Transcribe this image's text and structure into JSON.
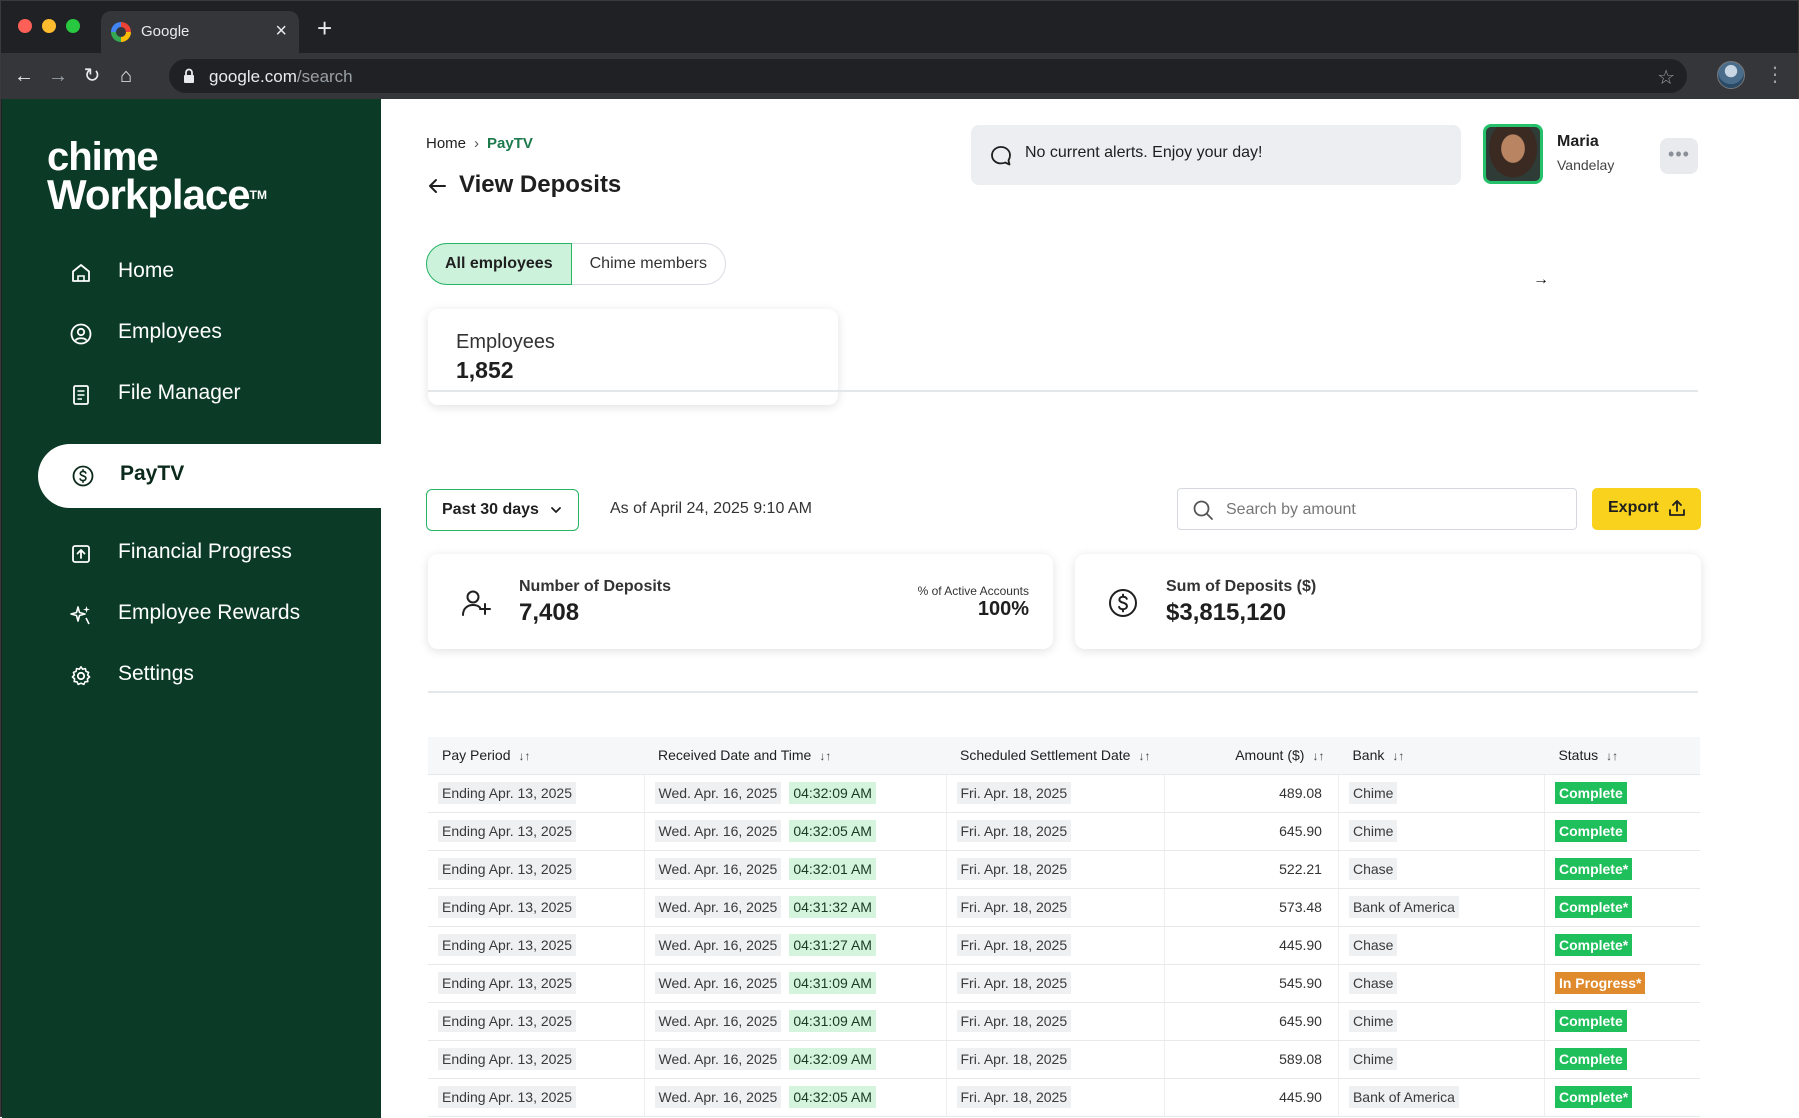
{
  "browser": {
    "tab_title": "Google",
    "url_host": "google.com",
    "url_path": "/search"
  },
  "sidebar": {
    "logo_line1": "chime",
    "logo_line2": "Workplace",
    "logo_tm": "TM",
    "items": [
      {
        "label": "Home",
        "icon": "home-icon"
      },
      {
        "label": "Employees",
        "icon": "user-circle-icon"
      },
      {
        "label": "File Manager",
        "icon": "document-icon"
      },
      {
        "label": "PayTV",
        "icon": "dollar-circle-icon",
        "active": true
      },
      {
        "label": "Financial Progress",
        "icon": "arrow-up-box-icon"
      },
      {
        "label": "Employee Rewards",
        "icon": "sparkles-icon"
      },
      {
        "label": "Settings",
        "icon": "gear-icon"
      }
    ]
  },
  "header": {
    "breadcrumb_home": "Home",
    "breadcrumb_current": "PayTV",
    "title": "View Deposits",
    "alert": "No current alerts. Enjoy your day!",
    "user_first": "Maria",
    "user_last": "Vandelay",
    "more_label": "•••"
  },
  "segments": {
    "all": "All employees",
    "chime": "Chime members"
  },
  "employees_card": {
    "label": "Employees",
    "value": "1,852"
  },
  "filters": {
    "range": "Past 30 days",
    "as_of": "As of April 24, 2025 9:10 AM",
    "search_placeholder": "Search by amount",
    "export": "Export"
  },
  "stats": {
    "deposits_label": "Number of Deposits",
    "deposits_value": "7,408",
    "active_label": "% of Active Accounts",
    "active_value": "100%",
    "sum_label": "Sum of Deposits ($)",
    "sum_value": "$3,815,120"
  },
  "table": {
    "headers": [
      "Pay Period",
      "Received Date and Time",
      "Scheduled Settlement Date",
      "Amount ($)",
      "Bank",
      "Status"
    ],
    "rows": [
      {
        "period": "Ending Apr. 13, 2025",
        "date": "Wed. Apr. 16, 2025",
        "time": "04:32:09 AM",
        "settle": "Fri. Apr. 18, 2025",
        "amount": "489.08",
        "bank": "Chime",
        "status": "Complete",
        "kind": "complete"
      },
      {
        "period": "Ending Apr. 13, 2025",
        "date": "Wed. Apr. 16, 2025",
        "time": "04:32:05 AM",
        "settle": "Fri. Apr. 18, 2025",
        "amount": "645.90",
        "bank": "Chime",
        "status": "Complete",
        "kind": "complete"
      },
      {
        "period": "Ending Apr. 13, 2025",
        "date": "Wed. Apr. 16, 2025",
        "time": "04:32:01 AM",
        "settle": "Fri. Apr. 18, 2025",
        "amount": "522.21",
        "bank": "Chase",
        "status": "Complete*",
        "kind": "complete"
      },
      {
        "period": "Ending Apr. 13, 2025",
        "date": "Wed. Apr. 16, 2025",
        "time": "04:31:32 AM",
        "settle": "Fri. Apr. 18, 2025",
        "amount": "573.48",
        "bank": "Bank of America",
        "status": "Complete*",
        "kind": "complete"
      },
      {
        "period": "Ending Apr. 13, 2025",
        "date": "Wed. Apr. 16, 2025",
        "time": "04:31:27 AM",
        "settle": "Fri. Apr. 18, 2025",
        "amount": "445.90",
        "bank": "Chase",
        "status": "Complete*",
        "kind": "complete"
      },
      {
        "period": "Ending Apr. 13, 2025",
        "date": "Wed. Apr. 16, 2025",
        "time": "04:31:09 AM",
        "settle": "Fri. Apr. 18, 2025",
        "amount": "545.90",
        "bank": "Chase",
        "status": "In Progress*",
        "kind": "progress"
      },
      {
        "period": "Ending Apr. 13, 2025",
        "date": "Wed. Apr. 16, 2025",
        "time": "04:31:09 AM",
        "settle": "Fri. Apr. 18, 2025",
        "amount": "645.90",
        "bank": "Chime",
        "status": "Complete",
        "kind": "complete"
      },
      {
        "period": "Ending Apr. 13, 2025",
        "date": "Wed. Apr. 16, 2025",
        "time": "04:32:09 AM",
        "settle": "Fri. Apr. 18, 2025",
        "amount": "589.08",
        "bank": "Chime",
        "status": "Complete",
        "kind": "complete"
      },
      {
        "period": "Ending Apr. 13, 2025",
        "date": "Wed. Apr. 16, 2025",
        "time": "04:32:05 AM",
        "settle": "Fri. Apr. 18, 2025",
        "amount": "445.90",
        "bank": "Bank of America",
        "status": "Complete*",
        "kind": "complete"
      }
    ]
  },
  "colors": {
    "sidebar_bg": "#0b3a27",
    "accent_green": "#27b463",
    "status_complete": "#1fbf5c",
    "status_progress": "#e08a2e",
    "export_yellow": "#f8d21c"
  }
}
